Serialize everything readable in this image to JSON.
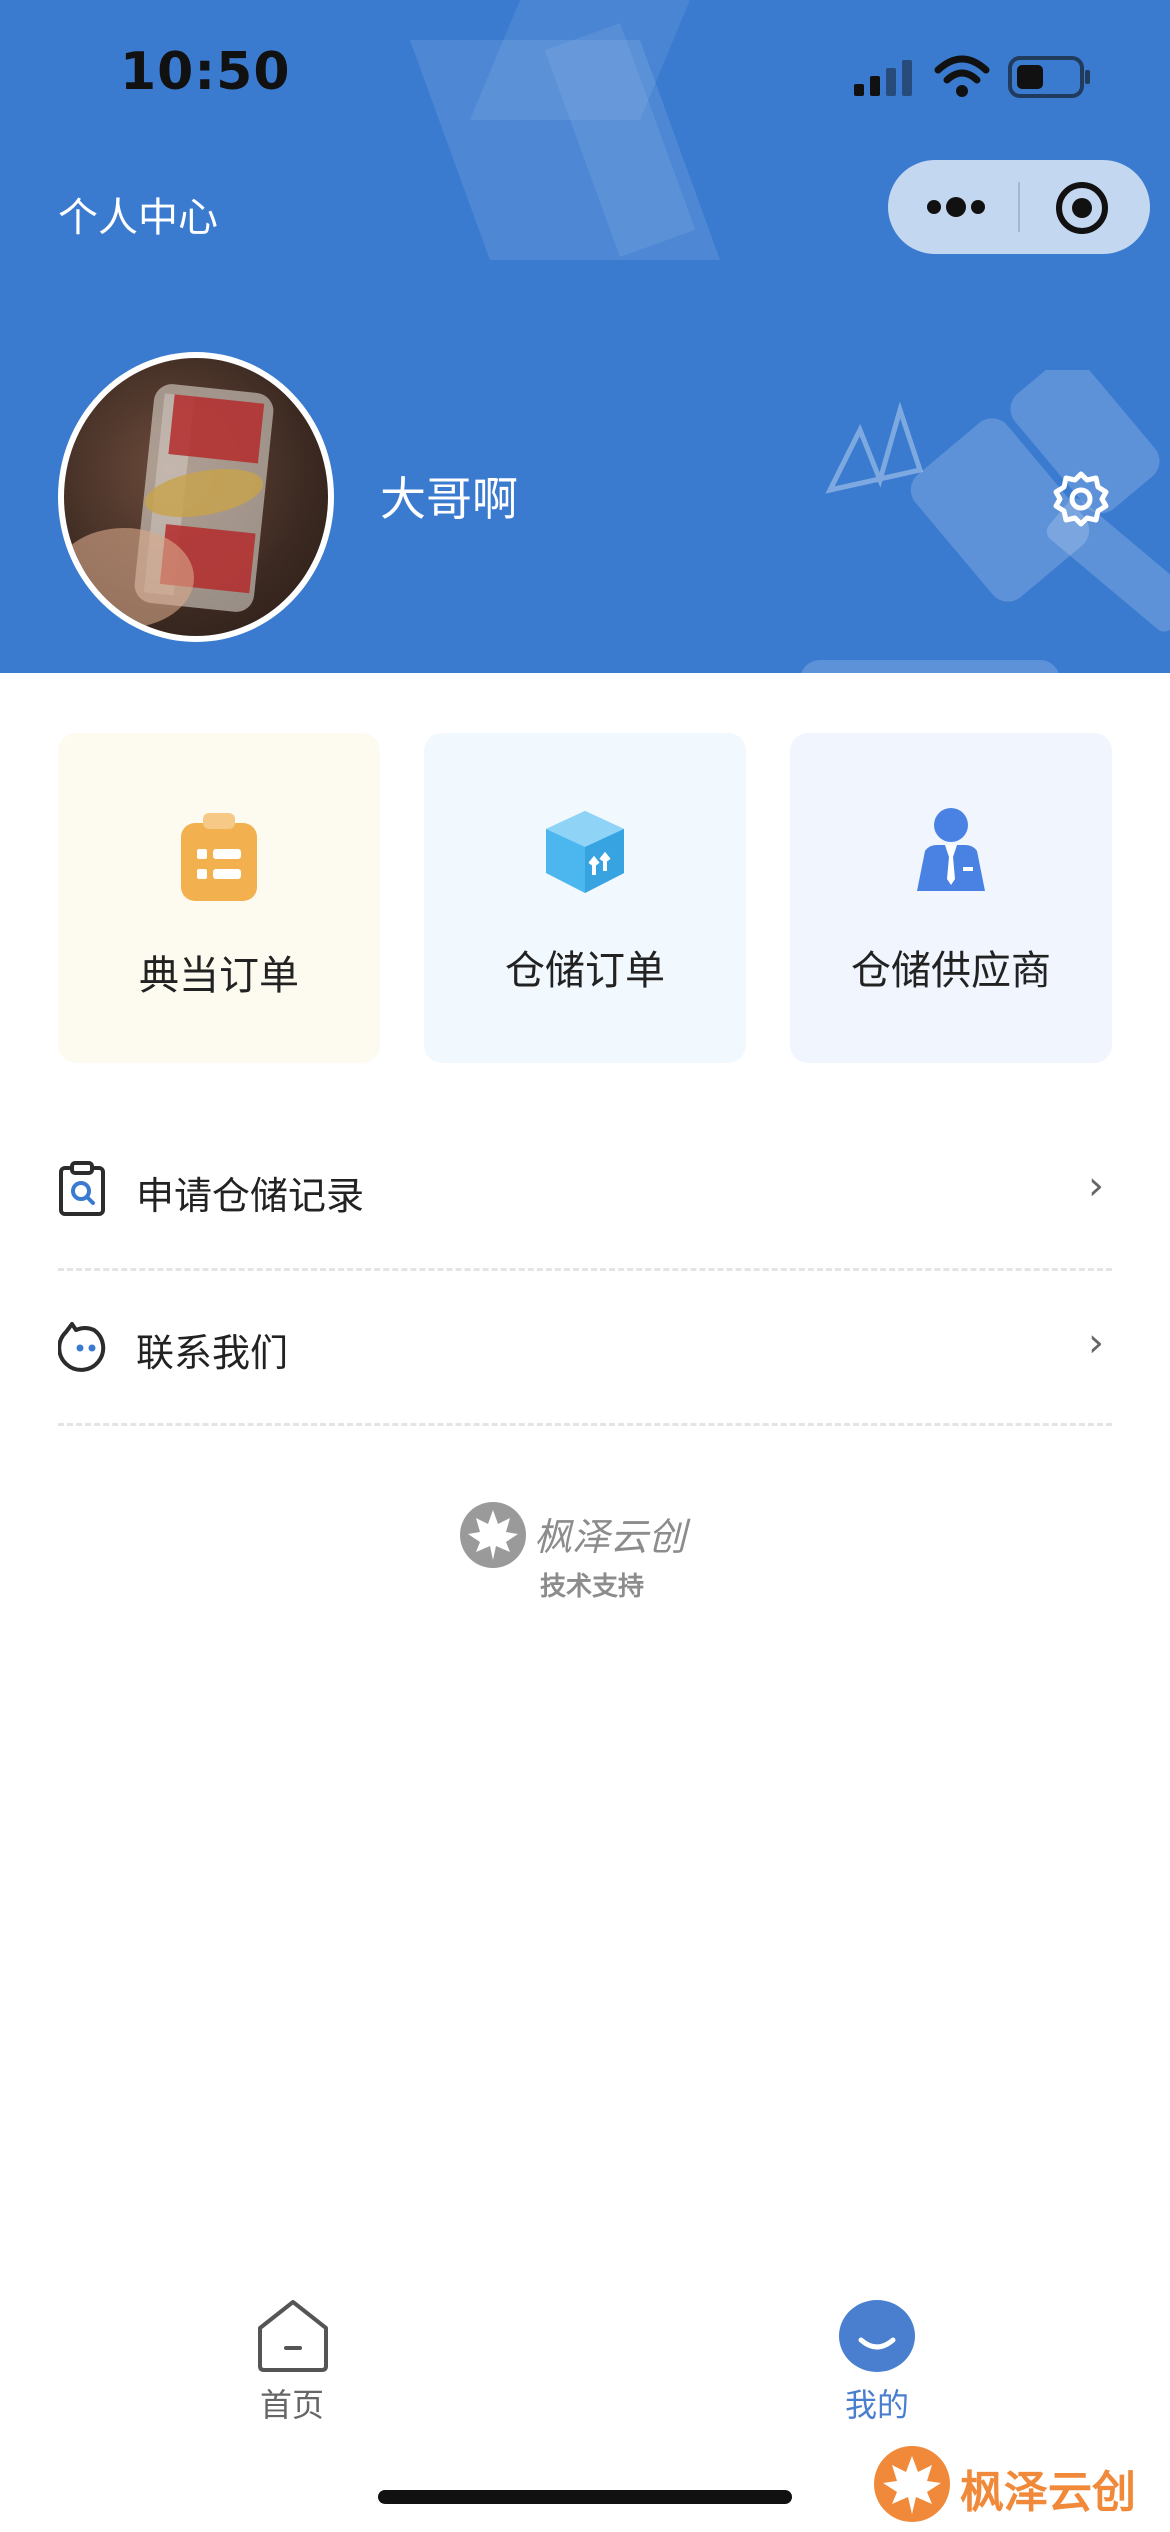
{
  "status_bar": {
    "time": "10:50"
  },
  "header": {
    "title": "个人中心",
    "username": "大哥啊"
  },
  "cards": [
    {
      "label": "典当订单",
      "bg": "#fdfaf0",
      "icon": "clipboard-icon",
      "color": "#f3b04f"
    },
    {
      "label": "仓储订单",
      "bg": "#f1f8fe",
      "icon": "box-icon",
      "color": "#4cb6ef"
    },
    {
      "label": "仓储供应商",
      "bg": "#f0f5fe",
      "icon": "supplier-icon",
      "color": "#4a82e4"
    }
  ],
  "menu": [
    {
      "label": "申请仓储记录",
      "icon": "record-search-icon"
    },
    {
      "label": "联系我们",
      "icon": "contact-icon"
    }
  ],
  "footer": {
    "brand": "枫泽云创",
    "support": "技术支持"
  },
  "tabbar": {
    "items": [
      {
        "label": "首页",
        "icon": "home-icon",
        "active": false
      },
      {
        "label": "我的",
        "icon": "profile-icon",
        "active": true
      }
    ],
    "active_color": "#4a7fcf",
    "inactive_color": "#666666"
  },
  "watermark": {
    "text": "枫泽云创"
  }
}
